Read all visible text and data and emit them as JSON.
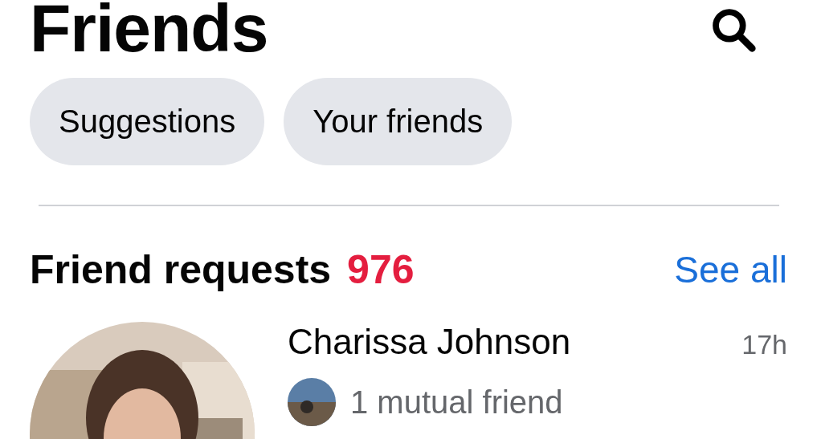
{
  "header": {
    "title": "Friends"
  },
  "filters": [
    {
      "label": "Suggestions"
    },
    {
      "label": "Your friends"
    }
  ],
  "requests": {
    "title": "Friend requests",
    "count": "976",
    "see_all": "See all",
    "items": [
      {
        "name": "Charissa Johnson",
        "time": "17h",
        "mutual": "1 mutual friend"
      }
    ]
  }
}
